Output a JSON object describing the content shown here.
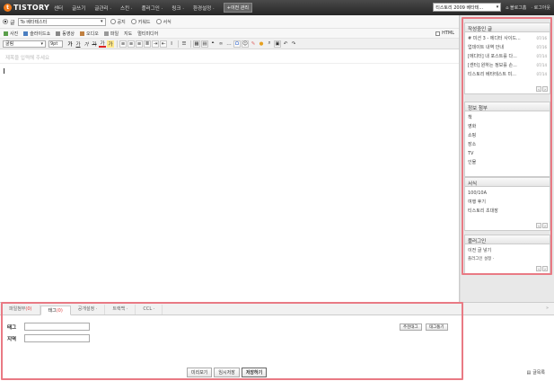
{
  "topbar": {
    "logo_text": "TISTORY",
    "nav": [
      "센터",
      "글쓰기",
      "글관리 ·",
      "스킨 ·",
      "플러그인 ·",
      "링크 ·",
      "환경설정 ·"
    ],
    "old_admin": "+이전 관리",
    "blog_select": "티스토리 2009 베타테...",
    "blog_home": "블로그홈",
    "logout": "로그아웃"
  },
  "editor": {
    "category_radio": "글",
    "category_select": "To 베타테스터",
    "options": [
      "공지",
      "키워드",
      "서식"
    ],
    "media": [
      "사진",
      "슬라이드쇼",
      "동영상",
      "오디오",
      "파일",
      "지도",
      "멀티미디어"
    ],
    "html_label": "HTML",
    "font_select": "굴림",
    "size_select": "9pt",
    "title_placeholder": "제목을 입력해 주세요"
  },
  "sidebar": {
    "drafts": {
      "title": "작성중인 글",
      "items": [
        {
          "text": "# 미션 3 - 에디터 사이드...",
          "date": "07/16"
        },
        {
          "text": "업데이트 내역 안내",
          "date": "07/16"
        },
        {
          "text": "[에디터] 내 포스트를 다...",
          "date": "07/14"
        },
        {
          "text": "[센터] 원하는 정보를 손...",
          "date": "07/14"
        },
        {
          "text": "티스토리 베타테스트 미...",
          "date": "07/14"
        }
      ]
    },
    "info": {
      "title": "정보 첨부",
      "items": [
        "책",
        "영화",
        "쇼핑",
        "장소",
        "TV",
        "인물"
      ]
    },
    "forms": {
      "title": "서식",
      "items": [
        "100/10A",
        "여행 후기",
        "티스토리 초대장"
      ]
    },
    "plugins": {
      "title": "플러그인",
      "items": [
        "이전 글 넣기"
      ],
      "setting": "플러그인 설정 ·"
    }
  },
  "bottom": {
    "tabs": [
      {
        "label": "파일첨부",
        "count": "(0)"
      },
      {
        "label": "태그",
        "count": "(0)"
      },
      {
        "label": "공개설정 ·",
        "count": ""
      },
      {
        "label": "트랙백 ·",
        "count": ""
      },
      {
        "label": "CCL ·",
        "count": ""
      }
    ],
    "tag_label": "태그",
    "location_label": "지역",
    "recommend_tag": "추천태그",
    "tag_cloud": "태그통기",
    "preview": "미리보기",
    "save_temp": "임시저장",
    "save": "저장하기",
    "list": "글목록"
  },
  "colors": {
    "highlight": "#e97a84",
    "logo": "#f07818",
    "topbar": "#2b2b2b"
  }
}
